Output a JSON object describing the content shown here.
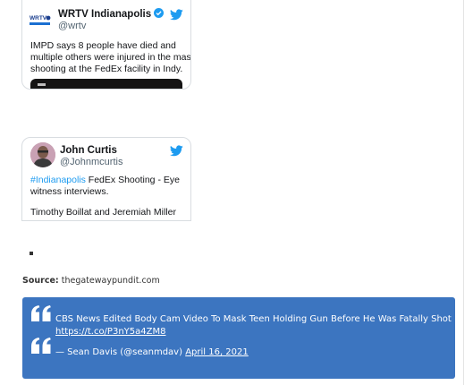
{
  "tweets": [
    {
      "author_name": "WRTV Indianapolis",
      "handle": "@wrtv",
      "verified": true,
      "avatar_logo": "WRTV",
      "text_lines": [
        "IMPD says 8 people have died and",
        "multiple others were injured in the mass",
        "shooting at the FedEx facility in Indy."
      ],
      "icons": {
        "bird": "twitter-bird-icon",
        "badge": "verified-badge-icon"
      }
    },
    {
      "author_name": "John Curtis",
      "handle": "@Johnmcurtis",
      "hashtag": "#Indianapolis",
      "text_line_1_rest": " FedEx Shooting - Eye",
      "text_line_2": "witness interviews.",
      "text_line_3": "Timothy Boillat and Jeremiah Miller",
      "icons": {
        "bird": "twitter-bird-icon"
      }
    }
  ],
  "source": {
    "label": "Source:",
    "value": "thegatewaypundit.com"
  },
  "blockquote": {
    "text": "CBS News Edited Body Cam Video To Mask Teen Holding Gun Before He Was Fatally Shot",
    "link": "https://t.co/P3nY5a4ZM8",
    "attribution": "— Sean Davis (@seanmdav) ",
    "date": "April 16, 2021"
  },
  "colors": {
    "quote_background": "#3c75c0",
    "twitter_blue": "#1d9bf0",
    "verified": "#1d9bf0",
    "avatar_2": "#c9a1b4"
  }
}
